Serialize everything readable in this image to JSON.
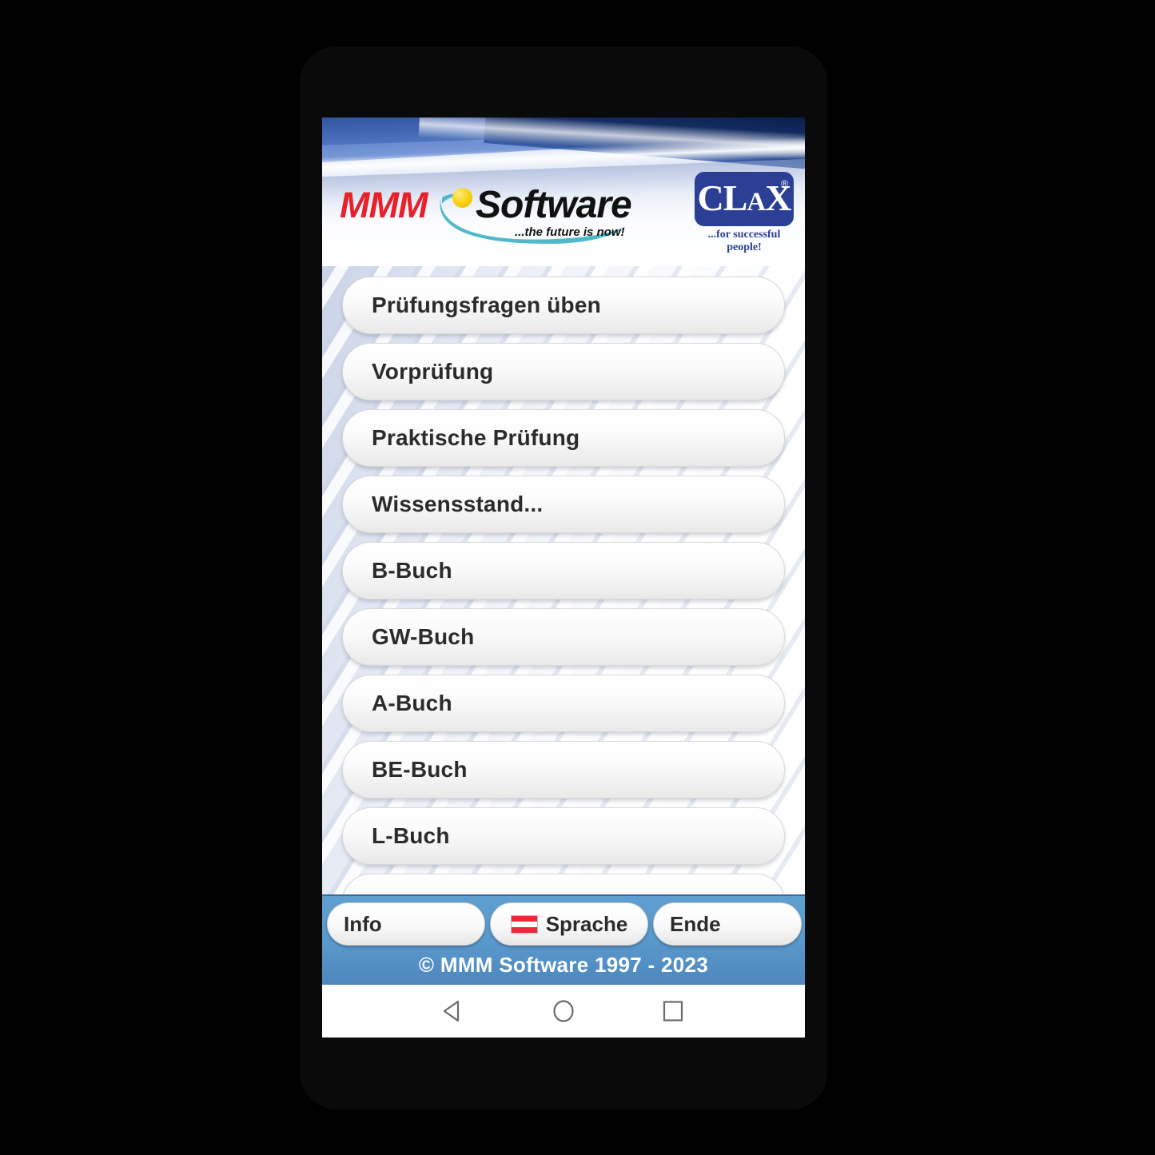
{
  "app": {
    "header": {
      "brand_name": "MMM",
      "brand_word": "Software",
      "brand_tagline": "...the future is now!",
      "product_logo_main": "CL",
      "product_logo_sub": "A",
      "product_logo_end": "X",
      "product_logo_reg": "®",
      "product_tagline": "...for successful people!"
    },
    "menu": {
      "items": [
        {
          "label": "Prüfungsfragen üben"
        },
        {
          "label": "Vorprüfung"
        },
        {
          "label": "Praktische Prüfung"
        },
        {
          "label": "Wissensstand..."
        },
        {
          "label": "B-Buch"
        },
        {
          "label": "GW-Buch"
        },
        {
          "label": "A-Buch"
        },
        {
          "label": "BE-Buch"
        },
        {
          "label": "L-Buch"
        },
        {
          "label": ""
        }
      ]
    },
    "toolbar": {
      "info_label": "Info",
      "sprache_label": "Sprache",
      "sprache_flag": "austria-flag-icon",
      "ende_label": "Ende",
      "copyright": "© MMM Software 1997 - 2023"
    },
    "navbar": {
      "back": "back-triangle-icon",
      "home": "home-circle-icon",
      "recents": "recents-square-icon"
    },
    "colors": {
      "toolbar_blue": "#5a99cc",
      "brand_red": "#e8202a",
      "clax_blue": "#2b3f95",
      "flag_red": "#ed2939",
      "accent_yellow": "#fcd417",
      "swoosh_teal": "#4fb8c9"
    }
  }
}
